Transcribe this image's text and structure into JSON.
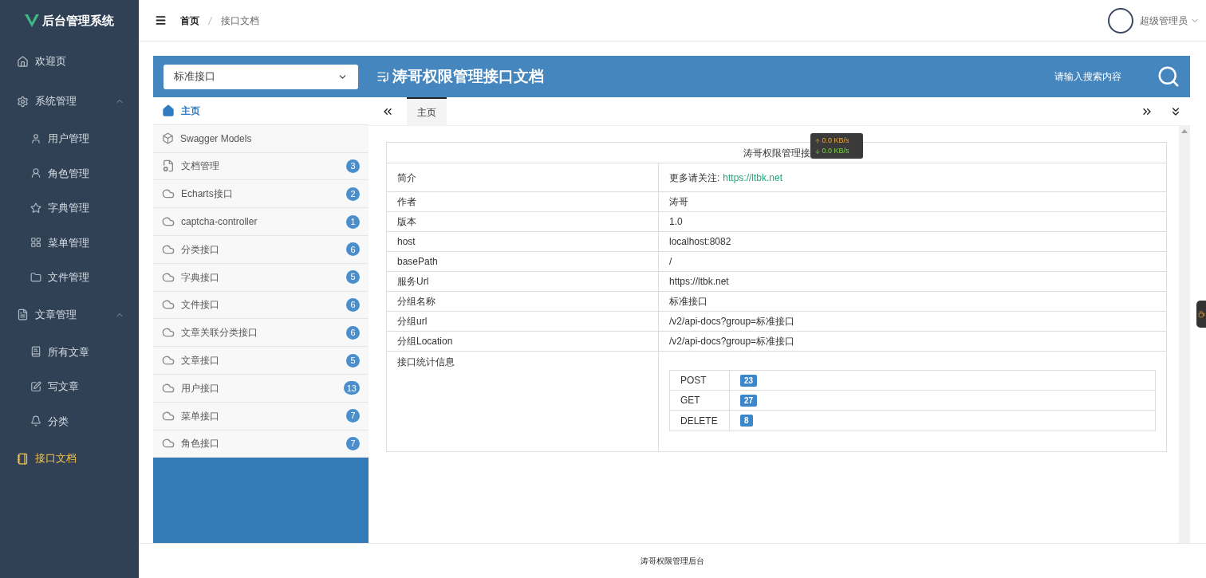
{
  "sidebar": {
    "logo_text": "后台管理系统",
    "items": [
      {
        "label": "欢迎页",
        "selected": false
      },
      {
        "label": "系统管理",
        "selected": false,
        "expanded": true,
        "children": [
          {
            "label": "用户管理",
            "selected": false
          },
          {
            "label": "角色管理",
            "selected": false
          },
          {
            "label": "字典管理",
            "selected": false
          },
          {
            "label": "菜单管理",
            "selected": false
          },
          {
            "label": "文件管理",
            "selected": false
          }
        ]
      },
      {
        "label": "文章管理",
        "selected": false,
        "expanded": true,
        "children": [
          {
            "label": "所有文章",
            "selected": false
          },
          {
            "label": "写文章",
            "selected": false
          },
          {
            "label": "分类",
            "selected": false
          }
        ]
      },
      {
        "label": "接口文档",
        "selected": true
      }
    ]
  },
  "header": {
    "breadcrumb": [
      "首页",
      "接口文档"
    ],
    "user": "超级管理员"
  },
  "doc": {
    "group_select": "标准接口",
    "title": "涛哥权限管理接口文档",
    "search_placeholder": "请输入搜索内容",
    "nav": [
      {
        "label": "主页",
        "selected": true
      },
      {
        "label": "Swagger Models",
        "selected": false
      },
      {
        "label": "文档管理",
        "count": "3",
        "selected": false
      },
      {
        "label": "Echarts接口",
        "count": "2",
        "selected": false
      },
      {
        "label": "captcha-controller",
        "count": "1",
        "selected": false
      },
      {
        "label": "分类接口",
        "count": "6",
        "selected": false
      },
      {
        "label": "字典接口",
        "count": "5",
        "selected": false
      },
      {
        "label": "文件接口",
        "count": "6",
        "selected": false
      },
      {
        "label": "文章关联分类接口",
        "count": "6",
        "selected": false
      },
      {
        "label": "文章接口",
        "count": "5",
        "selected": false
      },
      {
        "label": "用户接口",
        "count": "13",
        "selected": false
      },
      {
        "label": "菜单接口",
        "count": "7",
        "selected": false
      },
      {
        "label": "角色接口",
        "count": "7",
        "selected": false
      }
    ],
    "tabs": [
      {
        "label": "主页",
        "selected": true
      }
    ],
    "info": {
      "title": "涛哥权限管理接",
      "rows": [
        {
          "label": "简介",
          "value": "更多请关注:",
          "link": "https://ltbk.net"
        },
        {
          "label": "作者",
          "value": "涛哥"
        },
        {
          "label": "版本",
          "value": "1.0"
        },
        {
          "label": "host",
          "value": "localhost:8082"
        },
        {
          "label": "basePath",
          "value": "/"
        },
        {
          "label": "服务Url",
          "value": "https://ltbk.net"
        },
        {
          "label": "分组名称",
          "value": "标准接口"
        },
        {
          "label": "分组url",
          "value": "/v2/api-docs?group=标准接口"
        },
        {
          "label": "分组Location",
          "value": "/v2/api-docs?group=标准接口"
        }
      ],
      "stats_label": "接口统计信息",
      "stats": [
        {
          "method": "POST",
          "count": "23"
        },
        {
          "method": "GET",
          "count": "27"
        },
        {
          "method": "DELETE",
          "count": "8"
        }
      ]
    }
  },
  "speed_widget": {
    "up": "0.0 KB/s",
    "down": "0.0 KB/s"
  },
  "footer": "涛哥权限管理后台"
}
